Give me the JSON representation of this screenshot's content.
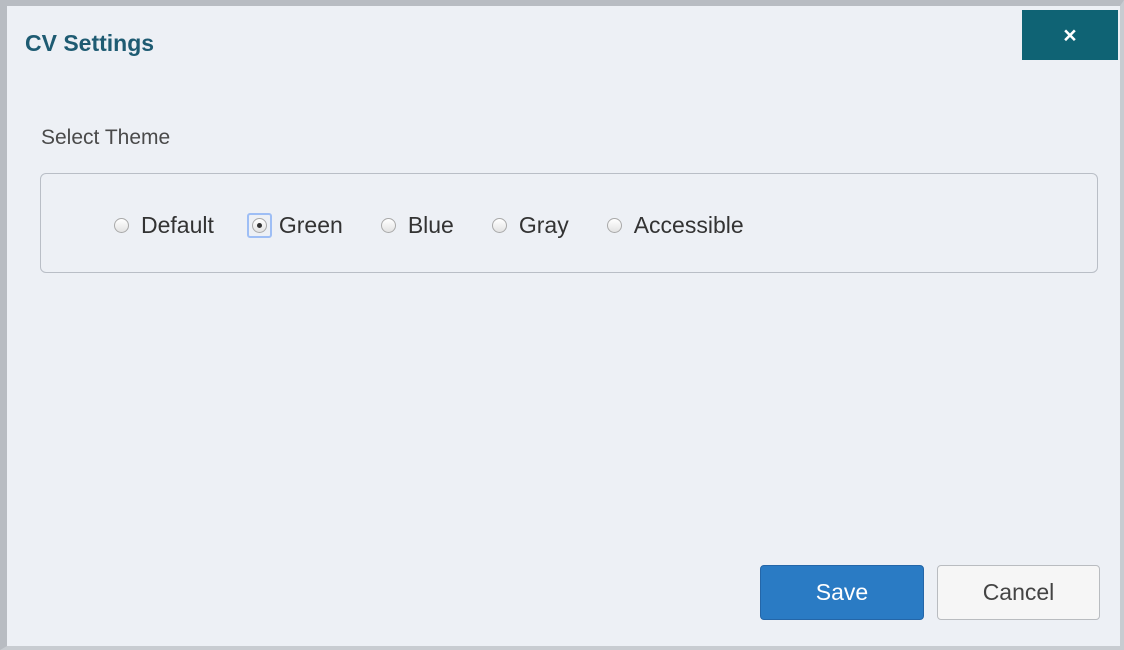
{
  "dialog": {
    "title": "CV Settings",
    "close_icon": "close-icon",
    "close_glyph": "×"
  },
  "theme": {
    "label": "Select Theme",
    "options": [
      {
        "label": "Default",
        "checked": false
      },
      {
        "label": "Green",
        "checked": true
      },
      {
        "label": "Blue",
        "checked": false
      },
      {
        "label": "Gray",
        "checked": false
      },
      {
        "label": "Accessible",
        "checked": false
      }
    ],
    "selected": "Green"
  },
  "actions": {
    "save_label": "Save",
    "cancel_label": "Cancel"
  },
  "colors": {
    "title": "#1e5b72",
    "close_button": "#0f6374",
    "save_button": "#2a7bc4",
    "background": "#edf0f5"
  }
}
